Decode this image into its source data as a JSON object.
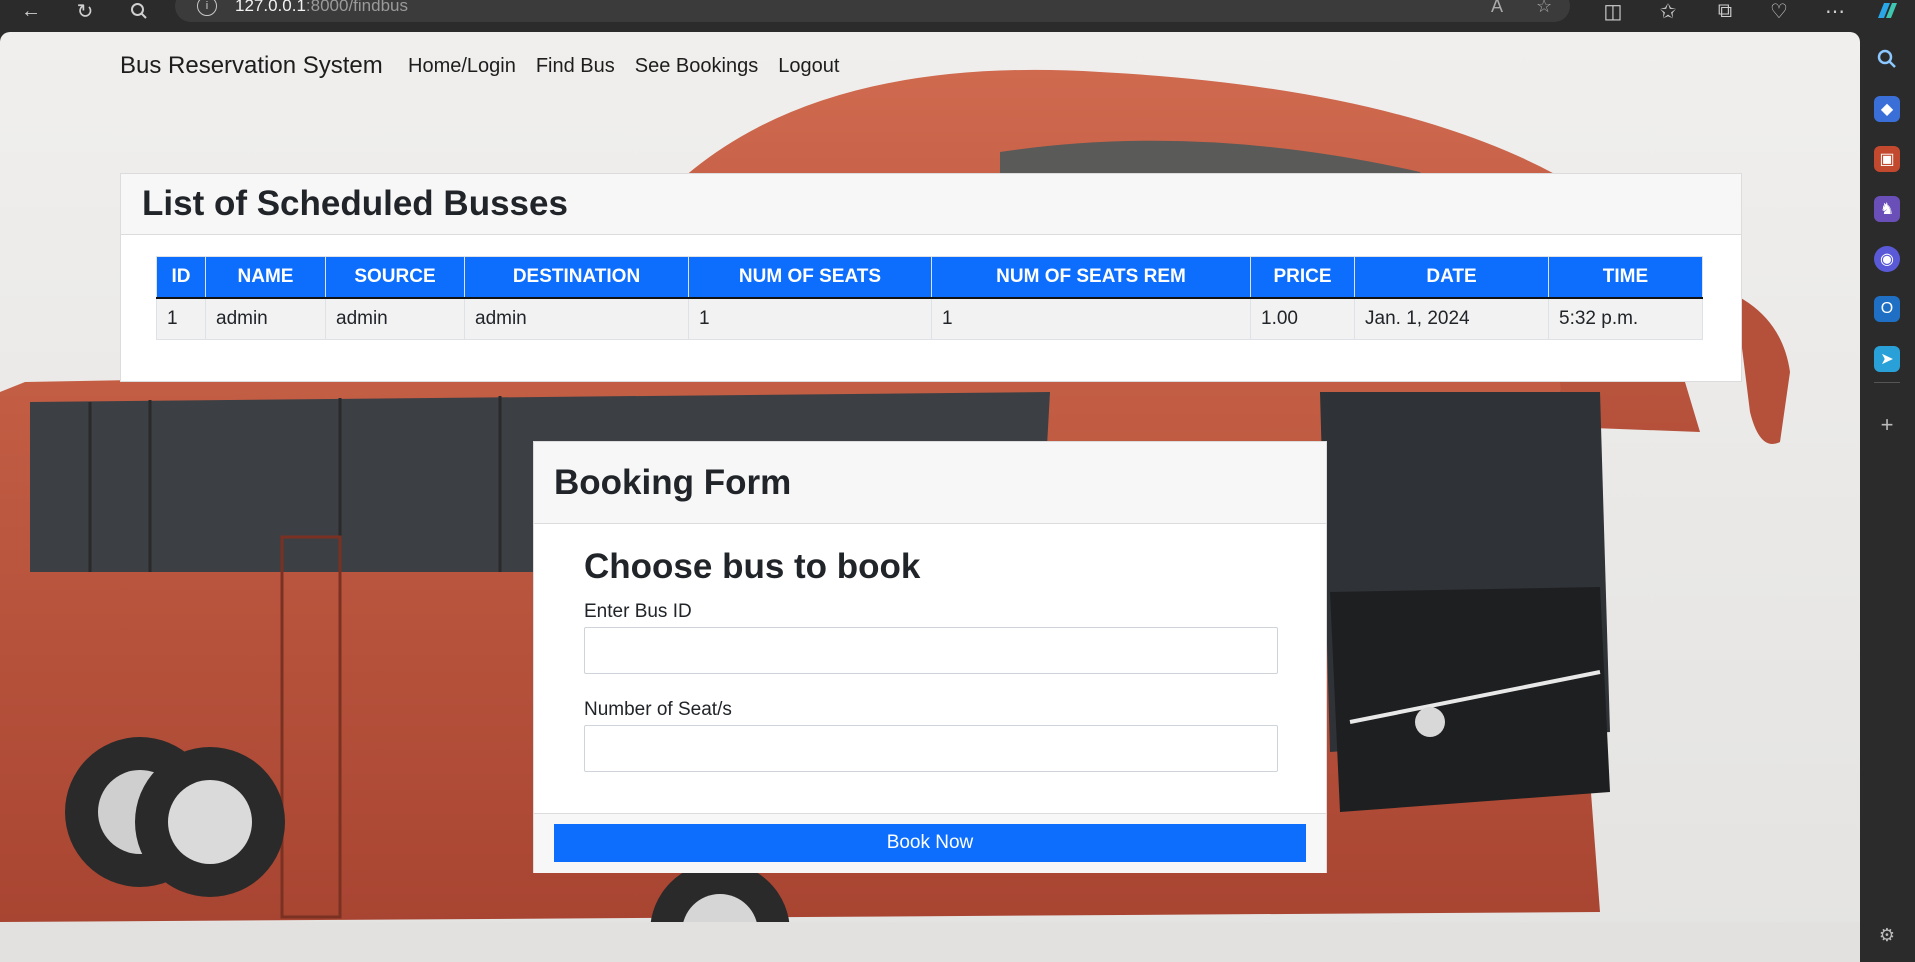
{
  "browser": {
    "url_host": "127.0.0.1",
    "url_rest": ":8000/findbus"
  },
  "navbar": {
    "brand": "Bus Reservation System",
    "links": [
      "Home/Login",
      "Find Bus",
      "See Bookings",
      "Logout"
    ]
  },
  "schedule": {
    "title": "List of Scheduled Busses",
    "columns": [
      "ID",
      "NAME",
      "SOURCE",
      "DESTINATION",
      "NUM OF SEATS",
      "NUM OF SEATS REM",
      "PRICE",
      "DATE",
      "TIME"
    ],
    "rows": [
      [
        "1",
        "admin",
        "admin",
        "admin",
        "1",
        "1",
        "1.00",
        "Jan. 1, 2024",
        "5:32 p.m."
      ]
    ]
  },
  "booking": {
    "title": "Booking Form",
    "subtitle": "Choose bus to book",
    "bus_id_label": "Enter Bus ID",
    "seats_label": "Number of Seat/s",
    "submit_label": "Book Now"
  },
  "colors": {
    "primary": "#0d6efd",
    "bus_body": "#b5503a"
  }
}
